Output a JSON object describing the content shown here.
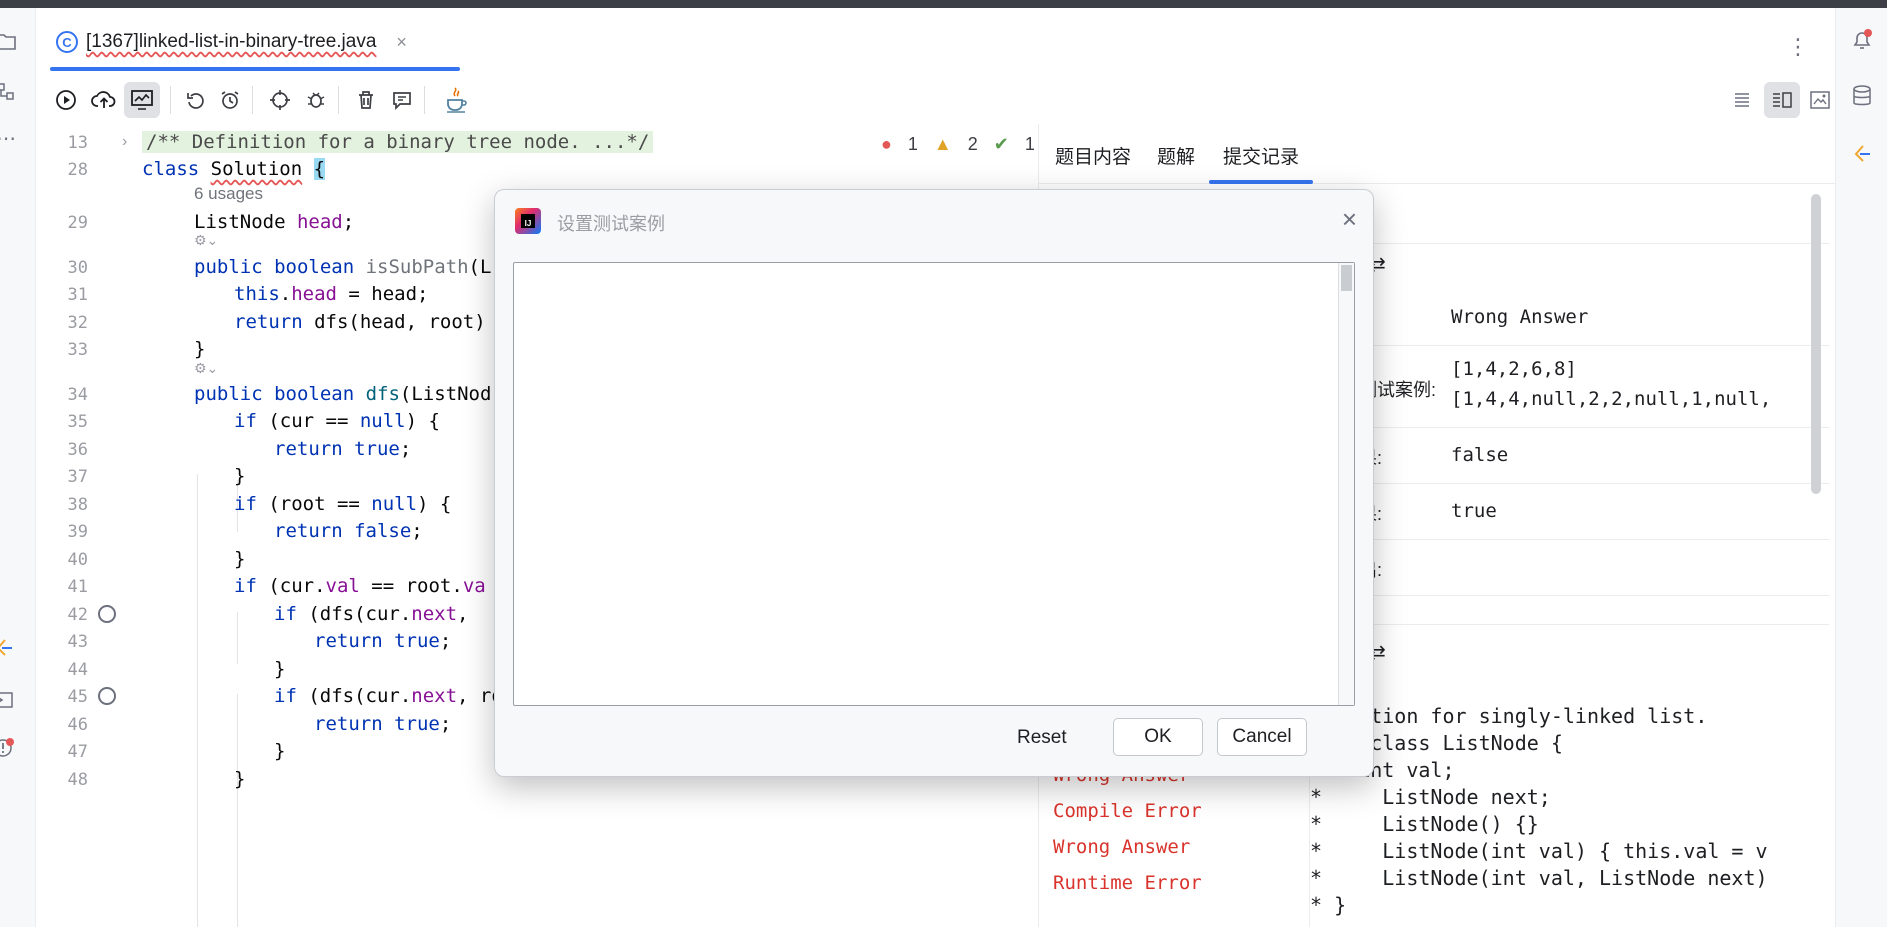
{
  "editor_tab": {
    "title": "[1367]linked-list-in-binary-tree.java",
    "icon": "class-c-icon",
    "close": "×"
  },
  "inspections": {
    "errors": "1",
    "warnings": "2",
    "weak_warnings": "1"
  },
  "code_lines": [
    {
      "ln": "13",
      "text": "/** Definition for a binary tree node. ...*/"
    },
    {
      "ln": "28",
      "text": "class Solution {"
    },
    {
      "ln": "",
      "text": "6 usages"
    },
    {
      "ln": "29",
      "text": "ListNode head;"
    },
    {
      "ln": "30",
      "text": "public boolean isSubPath(L"
    },
    {
      "ln": "31",
      "text": "this.head = head;"
    },
    {
      "ln": "32",
      "text": "return dfs(head, root)"
    },
    {
      "ln": "33",
      "text": "}"
    },
    {
      "ln": "34",
      "text": "public boolean dfs(ListNod"
    },
    {
      "ln": "35",
      "text": "if (cur == null) {"
    },
    {
      "ln": "36",
      "text": "return true;"
    },
    {
      "ln": "37",
      "text": "}"
    },
    {
      "ln": "38",
      "text": "if (root == null) {"
    },
    {
      "ln": "39",
      "text": "return false;"
    },
    {
      "ln": "40",
      "text": "}"
    },
    {
      "ln": "41",
      "text": "if (cur.val == root.va"
    },
    {
      "ln": "42",
      "text": "if (dfs(cur.next,"
    },
    {
      "ln": "43",
      "text": "return true;"
    },
    {
      "ln": "44",
      "text": "}"
    },
    {
      "ln": "45",
      "text": "if (dfs(cur.next, root.right)) {"
    },
    {
      "ln": "46",
      "text": "return true;"
    },
    {
      "ln": "47",
      "text": "}"
    },
    {
      "ln": "48",
      "text": "}"
    }
  ],
  "lc_panel": {
    "tabs": [
      "题目内容",
      "题解",
      "提交记录"
    ],
    "active_tab": "提交记录",
    "result": "Wrong Answer",
    "testcase_label": "测试案例:",
    "testcase_line1": "[1,4,2,6,8]",
    "testcase_line2": "[1,4,4,null,2,2,null,1,null,",
    "output_label": "果:",
    "output_value": "false",
    "expected_label": "果:",
    "expected_value": "true",
    "stdout_label": "出:",
    "section_icon": "⇄",
    "statuses": [
      "Wrong Answer",
      "Compile Error",
      "Wrong Answer",
      "Runtime Error"
    ],
    "code_preview": [
      "efinition for singly-linked list.",
      "blic class ListNode {",
      "    int val;",
      "*     ListNode next;",
      "*     ListNode() {}",
      "*     ListNode(int val) { this.val = v",
      "*     ListNode(int val, ListNode next)",
      "* }"
    ]
  },
  "dialog": {
    "title": "设置测试案例",
    "textarea_value": "",
    "reset_label": "Reset",
    "ok_label": "OK",
    "cancel_label": "Cancel",
    "close": "×"
  },
  "colors": {
    "accent": "#3574f0",
    "error": "#d9332b",
    "keyword": "#0033b3",
    "field": "#871094"
  }
}
